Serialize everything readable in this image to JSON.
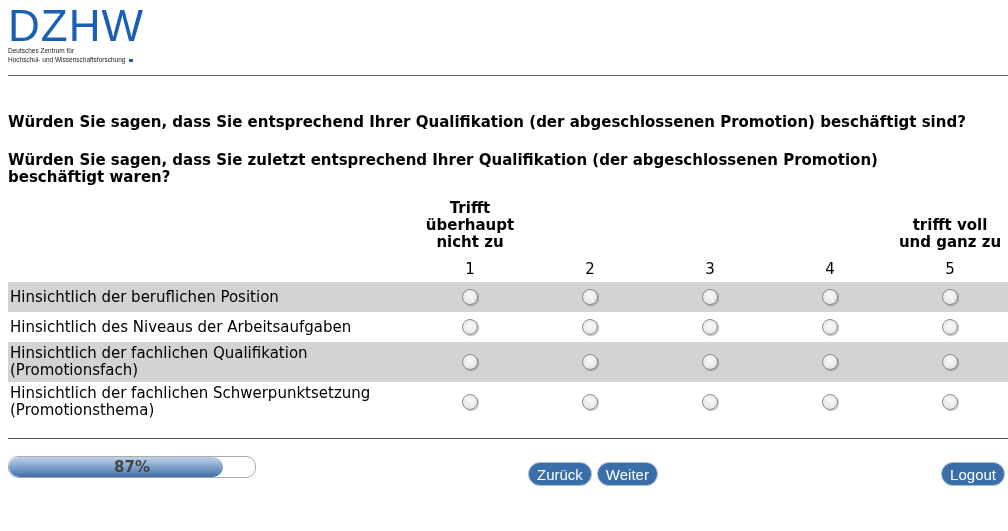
{
  "logo": {
    "name": "DZHW",
    "subtitle": [
      "Deutsches Zentrum für",
      "Hochschul- und Wissenschaftsforschung"
    ]
  },
  "questions": [
    "Würden Sie sagen, dass Sie entsprechend Ihrer Qualifikation (der abgeschlossenen Promotion) beschäftigt sind?",
    "Würden Sie sagen, dass Sie zuletzt entsprechend Ihrer Qualifikation (der abgeschlossenen Promotion) beschäftigt waren?"
  ],
  "scale": [
    {
      "label": "Trifft überhaupt nicht zu",
      "number": "1"
    },
    {
      "number": "2"
    },
    {
      "number": "3"
    },
    {
      "number": "4"
    },
    {
      "label": "trifft voll und ganz zu",
      "number": "5"
    }
  ],
  "items": [
    {
      "label": "Hinsichtlich der beruflichen Position",
      "options": [
        {
          "selected": false
        },
        {
          "selected": false
        },
        {
          "selected": false
        },
        {
          "selected": false
        },
        {
          "selected": false
        }
      ]
    },
    {
      "label": "Hinsichtlich des Niveaus der Arbeitsaufgaben",
      "options": [
        {
          "selected": false
        },
        {
          "selected": false
        },
        {
          "selected": false
        },
        {
          "selected": false
        },
        {
          "selected": false
        }
      ]
    },
    {
      "label": "Hinsichtlich der fachlichen Qualifikation (Promotionsfach)",
      "options": [
        {
          "selected": false
        },
        {
          "selected": false
        },
        {
          "selected": false
        },
        {
          "selected": false
        },
        {
          "selected": false
        }
      ]
    },
    {
      "label": "Hinsichtlich der fachlichen Schwerpunktsetzung (Promotionsthema)",
      "options": [
        {
          "selected": false
        },
        {
          "selected": false
        },
        {
          "selected": false
        },
        {
          "selected": false
        },
        {
          "selected": false
        }
      ]
    }
  ],
  "progress": {
    "level": 0.87,
    "reading": "87%"
  },
  "buttons": {
    "back": "Zurück",
    "next": "Weiter",
    "logout": "Logout"
  }
}
